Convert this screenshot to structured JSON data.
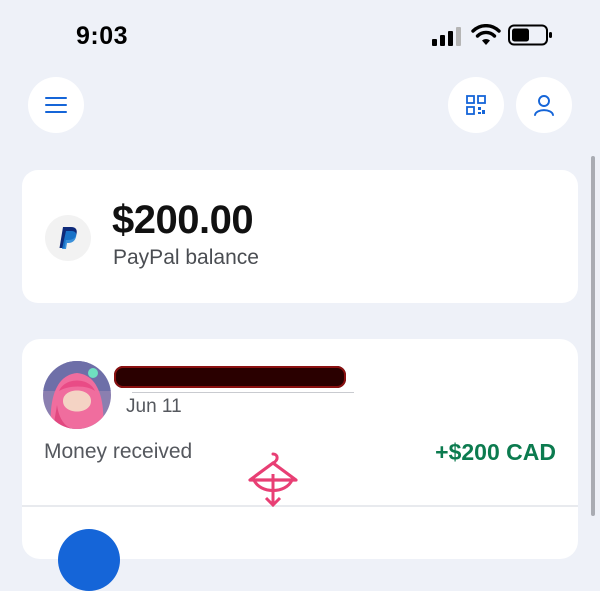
{
  "status_bar": {
    "time": "9:03",
    "icons": [
      "cellular-signal-icon",
      "wifi-icon",
      "battery-icon"
    ]
  },
  "header": {
    "menu_icon": "hamburger-menu-icon",
    "qr_icon": "qr-code-icon",
    "profile_icon": "person-icon"
  },
  "balance": {
    "amount": "$200.00",
    "label": "PayPal balance",
    "logo_icon": "paypal-logo-icon"
  },
  "activity": [
    {
      "avatar": "contact-avatar",
      "name_redacted": true,
      "date": "Jun 11",
      "type": "Money received",
      "amount": "+$200 CAD"
    }
  ],
  "colors": {
    "background": "#eef1f8",
    "card": "#ffffff",
    "accent_blue": "#1565d8",
    "positive_green": "#0c7b4f"
  }
}
